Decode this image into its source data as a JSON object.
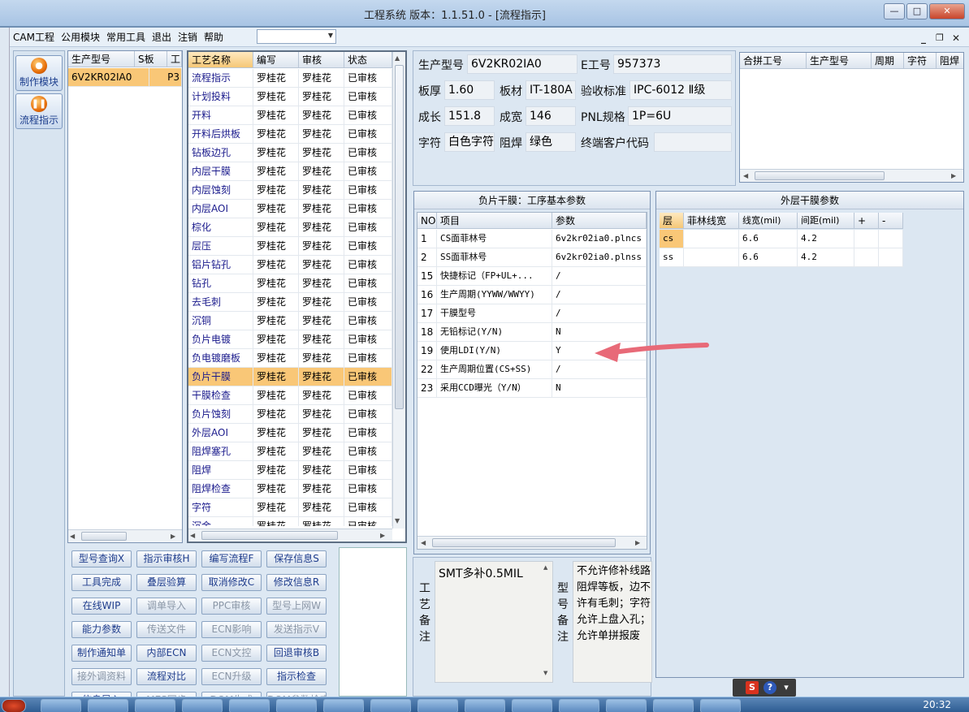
{
  "window": {
    "title": "工程系统   版本：1.1.51.0 - [流程指示]"
  },
  "menu": {
    "items": [
      "CAM工程",
      "公用模块",
      "常用工具",
      "退出",
      "注销",
      "帮助"
    ]
  },
  "nav": {
    "items": [
      "制作模块",
      "流程指示"
    ]
  },
  "models": {
    "headers": [
      "生产型号",
      "S板",
      "工"
    ],
    "rows": [
      [
        "6V2KR02IA0",
        "",
        "P3"
      ]
    ]
  },
  "process": {
    "headers": [
      "工艺名称",
      "编写",
      "审核",
      "状态"
    ],
    "rows": [
      [
        "流程指示",
        "罗桂花",
        "罗桂花",
        "已审核"
      ],
      [
        "计划投料",
        "罗桂花",
        "罗桂花",
        "已审核"
      ],
      [
        "开料",
        "罗桂花",
        "罗桂花",
        "已审核"
      ],
      [
        "开料后烘板",
        "罗桂花",
        "罗桂花",
        "已审核"
      ],
      [
        "钻板边孔",
        "罗桂花",
        "罗桂花",
        "已审核"
      ],
      [
        "内层干膜",
        "罗桂花",
        "罗桂花",
        "已审核"
      ],
      [
        "内层蚀刻",
        "罗桂花",
        "罗桂花",
        "已审核"
      ],
      [
        "内层AOI",
        "罗桂花",
        "罗桂花",
        "已审核"
      ],
      [
        "棕化",
        "罗桂花",
        "罗桂花",
        "已审核"
      ],
      [
        "层压",
        "罗桂花",
        "罗桂花",
        "已审核"
      ],
      [
        "铝片钻孔",
        "罗桂花",
        "罗桂花",
        "已审核"
      ],
      [
        "钻孔",
        "罗桂花",
        "罗桂花",
        "已审核"
      ],
      [
        "去毛刺",
        "罗桂花",
        "罗桂花",
        "已审核"
      ],
      [
        "沉铜",
        "罗桂花",
        "罗桂花",
        "已审核"
      ],
      [
        "负片电镀",
        "罗桂花",
        "罗桂花",
        "已审核"
      ],
      [
        "负电镀磨板",
        "罗桂花",
        "罗桂花",
        "已审核"
      ],
      [
        "负片干膜",
        "罗桂花",
        "罗桂花",
        "已审核"
      ],
      [
        "干膜检查",
        "罗桂花",
        "罗桂花",
        "已审核"
      ],
      [
        "负片蚀刻",
        "罗桂花",
        "罗桂花",
        "已审核"
      ],
      [
        "外层AOI",
        "罗桂花",
        "罗桂花",
        "已审核"
      ],
      [
        "阻焊塞孔",
        "罗桂花",
        "罗桂花",
        "已审核"
      ],
      [
        "阻焊",
        "罗桂花",
        "罗桂花",
        "已审核"
      ],
      [
        "阻焊检查",
        "罗桂花",
        "罗桂花",
        "已审核"
      ],
      [
        "字符",
        "罗桂花",
        "罗桂花",
        "已审核"
      ],
      [
        "沉金",
        "罗桂花",
        "罗桂花",
        "已审核"
      ]
    ],
    "selected_row": 16
  },
  "info": {
    "prod_model_label": "生产型号",
    "prod_model": "6V2KR02IA0",
    "e_no_label": "E工号",
    "e_no": "957373",
    "thickness_label": "板厚",
    "thickness": "1.60",
    "material_label": "板材",
    "material": "IT-180A",
    "standard_label": "验收标准",
    "standard": "IPC-6012 Ⅱ级",
    "length_label": "成长",
    "length": "151.8",
    "width_label": "成宽",
    "width": "146",
    "pnl_label": "PNL规格",
    "pnl": "1P=6U",
    "char_label": "字符",
    "char": "白色字符",
    "mask_label": "阻焊",
    "mask": "绿色",
    "enduser_label": "终端客户代码",
    "enduser": ""
  },
  "combine": {
    "headers": [
      "合拼工号",
      "生产型号",
      "周期",
      "字符",
      "阻焊"
    ]
  },
  "params": {
    "title": "负片干膜：工序基本参数",
    "headers": [
      "NO",
      "项目",
      "参数"
    ],
    "rows": [
      [
        "1",
        "CS面菲林号",
        "6v2kr02ia0.plncs"
      ],
      [
        "2",
        "SS面菲林号",
        "6v2kr02ia0.plnss"
      ],
      [
        "15",
        "快捷标记（FP+UL+...",
        "/"
      ],
      [
        "16",
        "生产周期(YYWW/WWYY)",
        "/"
      ],
      [
        "17",
        "干膜型号",
        "/"
      ],
      [
        "18",
        "无铅标记(Y/N)",
        "N"
      ],
      [
        "19",
        "使用LDI(Y/N)",
        "Y"
      ],
      [
        "22",
        "生产周期位置(CS+SS)",
        "/"
      ],
      [
        "23",
        "采用CCD曝光（Y/N）",
        "N"
      ]
    ]
  },
  "outer": {
    "title": "外层干膜参数",
    "headers": [
      "层",
      "菲林线宽",
      "线宽(mil)",
      "间距(mil)",
      "+",
      "-"
    ],
    "rows": [
      [
        "cs",
        "",
        "6.6",
        "4.2",
        "",
        ""
      ],
      [
        "ss",
        "",
        "6.6",
        "4.2",
        "",
        ""
      ]
    ]
  },
  "buttons": [
    [
      "型号查询X",
      "指示审核H",
      "编写流程F",
      "保存信息S"
    ],
    [
      "工具完成",
      "叠层验算",
      "取消修改C",
      "修改信息R"
    ],
    [
      "在线WIP",
      "调单导入",
      "PPC审核",
      "型号上网W"
    ],
    [
      "能力参数",
      "传送文件",
      "ECN影响",
      "发送指示V"
    ],
    [
      "制作通知单",
      "内部ECN",
      "ECN文控",
      "回退审核B"
    ],
    [
      "接外调资料",
      "流程对比",
      "ECN升级",
      "指示检查"
    ],
    [
      "信息导入",
      "MES同步",
      "DOM生成",
      "DOM参数检查"
    ]
  ],
  "disabled_buttons": [
    "调单导入",
    "PPC审核",
    "型号上网W",
    "传送文件",
    "ECN影响",
    "发送指示V",
    "ECN文控",
    "接外调资料",
    "ECN升级",
    "MES同步",
    "DOM生成",
    "DOM参数检查"
  ],
  "remarks": {
    "craft_label": "工艺备注",
    "craft_text": "SMT多补0.5MIL",
    "model_label": "型号备注",
    "model_text": "不允许修补线路\n阻焊等板，边不\n许有毛刺；字符\n允许上盘入孔；\n允许单拼报废"
  },
  "clock": "20:32",
  "colors": {
    "selected_row": "#f9c777",
    "arrow": "#e86a78"
  }
}
